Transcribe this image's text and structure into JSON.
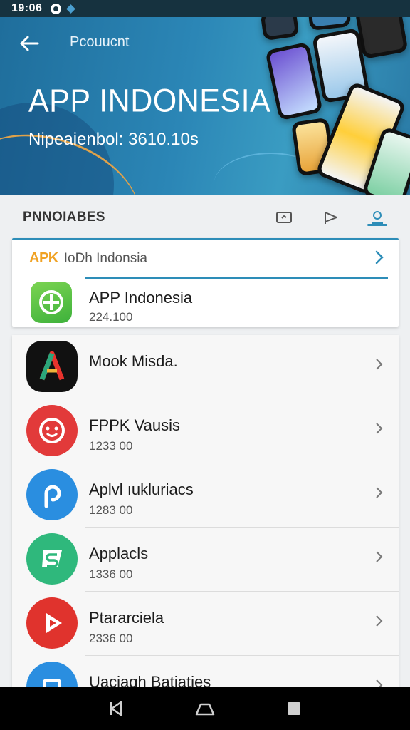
{
  "status_bar": {
    "time": "19:06"
  },
  "hero": {
    "label": "Pcouucnt",
    "title": "APP INDONESIA",
    "subtitle": "Nipeaienbol: 3610.10s"
  },
  "tabs": {
    "label": "PNNOIABES"
  },
  "featured": {
    "brand": "APK",
    "header": "IoDh Indonsia",
    "app_name": "APP Indonesia",
    "app_count": "224.100"
  },
  "apps": [
    {
      "name": "Mook Misda.",
      "count": "",
      "icon": "a-logo-icon",
      "color": "#111111"
    },
    {
      "name": "FPPK Vausis",
      "count": "1233 00",
      "icon": "smiley-icon",
      "color": "#e23a3a"
    },
    {
      "name": "Aplvl ıukluriacs",
      "count": "1283 00",
      "icon": "p-logo-icon",
      "color": "#2a8ee0"
    },
    {
      "name": "Applacls",
      "count": "1336 00",
      "icon": "s-logo-icon",
      "color": "#2fb87c"
    },
    {
      "name": "Ptararciela",
      "count": "2336 00",
      "icon": "play-icon",
      "color": "#e0332d"
    },
    {
      "name": "Uaciagh Batiaties",
      "count": "",
      "icon": "bag-icon",
      "color": "#2a8ee0"
    }
  ],
  "colors": {
    "accent": "#2d8db8",
    "hero": "#2b86b6"
  }
}
